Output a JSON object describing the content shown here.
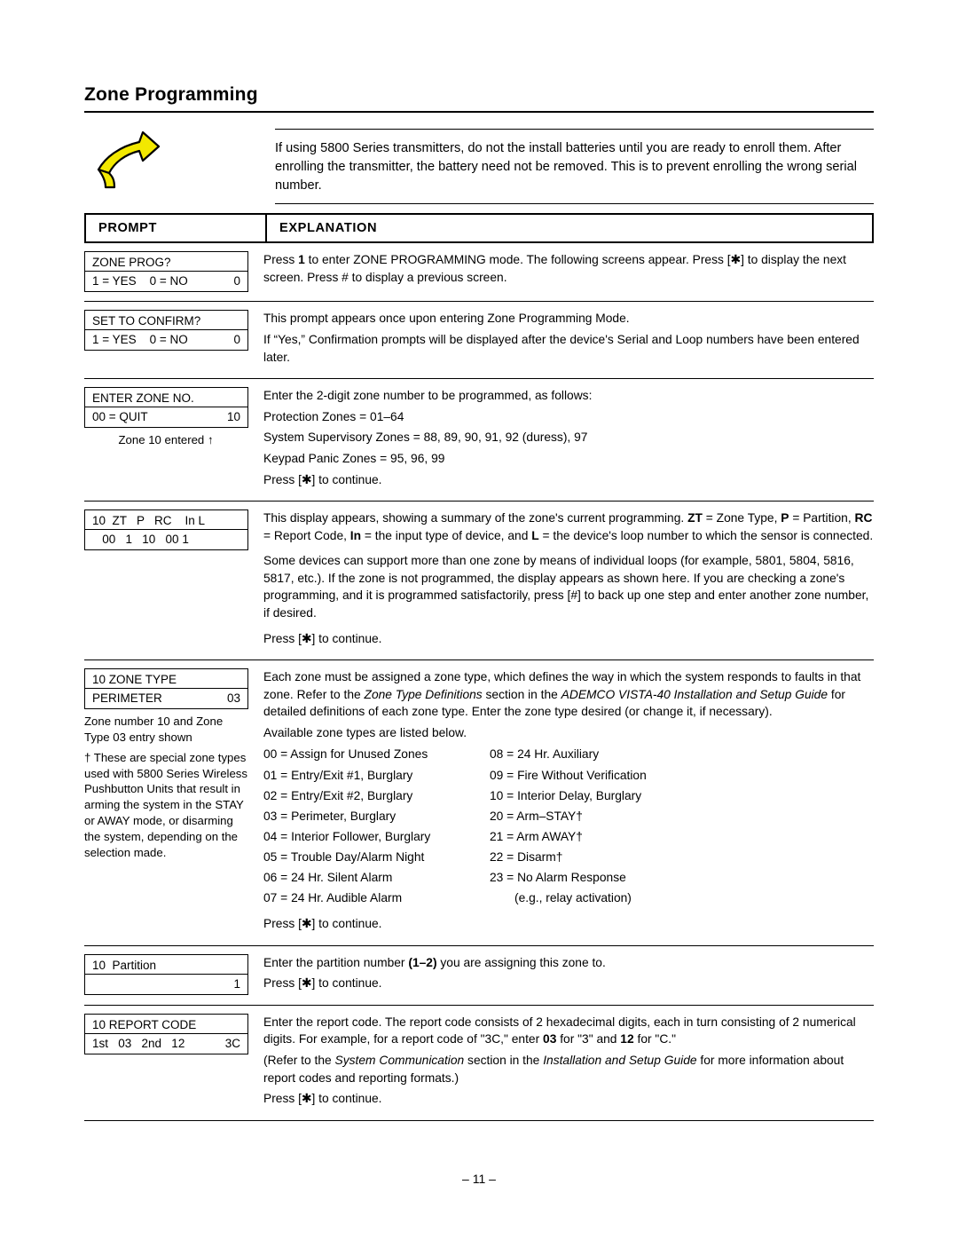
{
  "page": {
    "title": "Zone Programming",
    "footer": "– 11 –"
  },
  "note": {
    "icon": "hand-pointing-icon",
    "text": "If using 5800 Series transmitters, do not the install batteries until you are ready to enroll them. After enrolling the transmitter, the battery need not be removed. This is to prevent enrolling the wrong serial number."
  },
  "table": {
    "header": {
      "prompt": "PROMPT",
      "explanation": "EXPLANATION"
    },
    "rows": [
      {
        "prompt_line1": "ZONE PROG?",
        "prompt_line2_left": "1 = YES    0 = NO",
        "prompt_line2_right": "0",
        "explanation": [
          "Press 1 to enter ZONE PROGRAMMING mode. The following screens appear. Press [✱] to display the next screen. Press # to display a previous screen."
        ]
      },
      {
        "prompt_line1": "SET TO CONFIRM?",
        "prompt_line2_left": "1 = YES    0 = NO",
        "prompt_line2_right": "0",
        "explanation": [
          "This prompt appears once upon entering Zone Programming Mode.",
          "If “Yes,” Confirmation prompts will be displayed after the device's Serial and Loop numbers have been entered later."
        ]
      },
      {
        "prompt_line1": "ENTER ZONE NO.",
        "prompt_line2_left": "00 = QUIT",
        "prompt_line2_right": "10",
        "prompt_sub": "Zone 10 entered",
        "explanation": [
          "Enter the 2-digit zone number to be programmed, as follows:",
          "Protection Zones = 01–64",
          "System Supervisory Zones = 88, 89, 90, 91, 92 (duress), 97",
          "Keypad Panic Zones = 95, 96, 99",
          "Press [✱] to continue."
        ]
      },
      {
        "prompt_line1": "10  ZT   P   RC    In L",
        "prompt_line2_left": "   00   1   10   00 1",
        "prompt_line2_right": "",
        "explanation": [
          "This display appears, showing a summary of the zone's current programming.  ZT = Zone Type, P = Partition, RC = Report Code, In = the input type of device, and L = the device's loop number to which the sensor is connected.",
          "Some devices can support more than one zone by means of individual loops (for example, 5801, 5804, 5816, 5817, etc.).  If the zone is not programmed, the display appears as shown here.  If you are checking a zone's programming, and it is programmed satisfactorily, press [#] to back up one step and enter another zone number, if desired.",
          "Press [✱] to continue."
        ]
      },
      {
        "prompt_line1": "10 ZONE TYPE",
        "prompt_line2_left": "PERIMETER",
        "prompt_line2_right": "03",
        "prompt_sub": "Zone number 10 and Zone Type 03 entry shown",
        "prompt_footnote": "†   These are special zone types used with 5800 Series Wireless Pushbutton Units that result in arming the system in the STAY or AWAY mode, or disarming the system, depending on the selection made.",
        "explanation": [
          "Each zone must be assigned a zone type, which defines the way in which the system responds to faults in that zone.  Refer to the Zone Type Definitions section in the ADEMCO VISTA-40 Installation and Setup Guide for detailed definitions of each zone type.  Enter the zone type desired (or change it, if necessary).",
          "Available zone types are listed below.",
          "Press [✱] to continue."
        ],
        "zone_types_left": [
          "00 = Assign for Unused Zones",
          "01 = Entry/Exit #1, Burglary",
          "02 = Entry/Exit #2, Burglary",
          "03 = Perimeter, Burglary",
          "04 = Interior Follower, Burglary",
          "05 = Trouble Day/Alarm Night",
          "06 = 24 Hr. Silent Alarm",
          "07 = 24 Hr. Audible Alarm"
        ],
        "zone_types_right": [
          "08 = 24 Hr. Auxiliary",
          "09 = Fire Without Verification",
          "10 = Interior Delay, Burglary",
          "20 = Arm–STAY†",
          "21 = Arm AWAY†",
          "22 = Disarm†",
          "23 = No Alarm Response",
          "(e.g., relay activation)"
        ]
      },
      {
        "prompt_line1": "10  Partition",
        "prompt_line2_left": "",
        "prompt_line2_right": "1",
        "explanation": [
          "Enter the partition number (1–2) you are assigning this zone to.",
          "Press [✱] to continue."
        ]
      },
      {
        "prompt_line1": "10 REPORT CODE",
        "prompt_line2_left": "1st   03   2nd   12",
        "prompt_line2_right": "3C",
        "explanation": [
          "Enter the report code. The report code consists of 2 hexadecimal digits, each in turn consisting of 2 numerical digits. For example, for a report code of \"3C,\" enter 03 for \"3\" and 12 for \"C.\"",
          "(Refer to the System Communication section in the Installation and Setup Guide for more information about report codes and reporting formats.)",
          "Press [✱] to continue."
        ]
      }
    ]
  }
}
